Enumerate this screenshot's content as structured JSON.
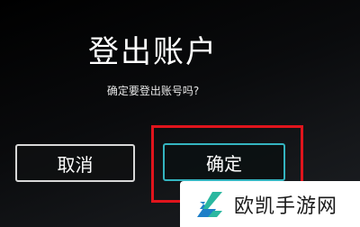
{
  "dialog": {
    "title": "登出账户",
    "message": "确定要登出账号吗?",
    "cancel_label": "取消",
    "confirm_label": "确定"
  },
  "watermark": {
    "text": "欧凯手游网",
    "logo_icon": "oukai-logo-icon",
    "logo_colors": [
      "#2bb8a0",
      "#1e7fc8"
    ]
  },
  "colors": {
    "confirm_border": "#34b4c0",
    "cancel_border": "#d8d8d8",
    "highlight": "#e0141c"
  }
}
